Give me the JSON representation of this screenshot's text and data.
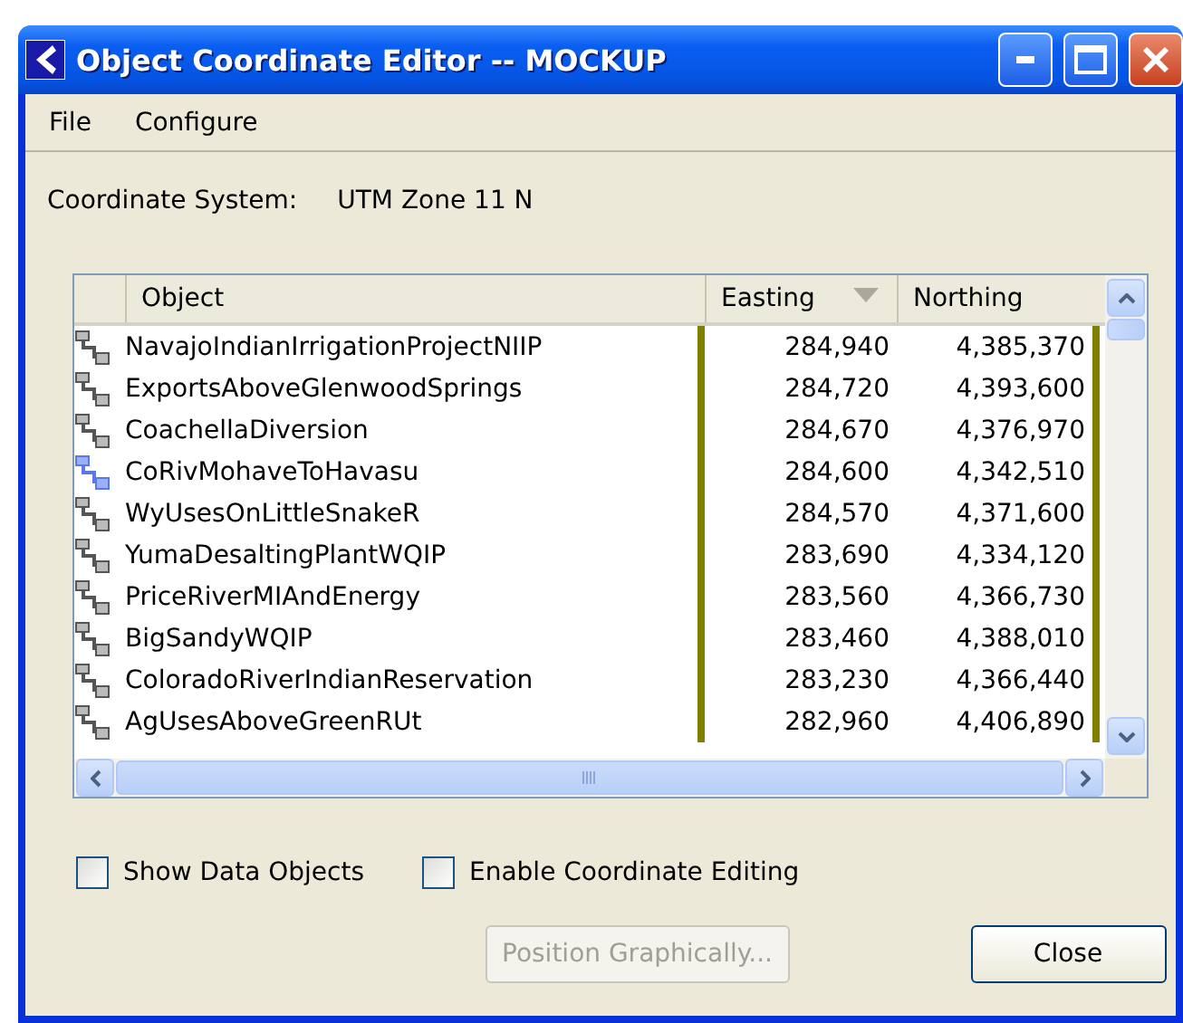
{
  "window": {
    "title": "Object Coordinate Editor -- MOCKUP"
  },
  "menu": [
    "File",
    "Configure"
  ],
  "coordinate_system": {
    "label": "Coordinate System:",
    "value": "UTM Zone 11 N"
  },
  "table": {
    "columns": [
      {
        "label": "Object",
        "sorted": false
      },
      {
        "label": "Easting",
        "sorted": true
      },
      {
        "label": "Northing",
        "sorted": false
      }
    ],
    "rows": [
      {
        "kind": "standard",
        "object": "NavajoIndianIrrigationProjectNIIP",
        "easting": "284,940",
        "northing": "4,385,370"
      },
      {
        "kind": "standard",
        "object": "ExportsAboveGlenwoodSprings",
        "easting": "284,720",
        "northing": "4,393,600"
      },
      {
        "kind": "standard",
        "object": "CoachellaDiversion",
        "easting": "284,670",
        "northing": "4,376,970"
      },
      {
        "kind": "alternate",
        "object": "CoRivMohaveToHavasu",
        "easting": "284,600",
        "northing": "4,342,510"
      },
      {
        "kind": "standard",
        "object": "WyUsesOnLittleSnakeR",
        "easting": "284,570",
        "northing": "4,371,600"
      },
      {
        "kind": "standard",
        "object": "YumaDesaltingPlantWQIP",
        "easting": "283,690",
        "northing": "4,334,120"
      },
      {
        "kind": "standard",
        "object": "PriceRiverMIAndEnergy",
        "easting": "283,560",
        "northing": "4,366,730"
      },
      {
        "kind": "standard",
        "object": "BigSandyWQIP",
        "easting": "283,460",
        "northing": "4,388,010"
      },
      {
        "kind": "standard",
        "object": "ColoradoRiverIndianReservation",
        "easting": "283,230",
        "northing": "4,366,440"
      },
      {
        "kind": "standard",
        "object": "AgUsesAboveGreenRUt",
        "easting": "282,960",
        "northing": "4,406,890"
      }
    ]
  },
  "checkboxes": [
    {
      "label": "Show Data Objects",
      "checked": false
    },
    {
      "label": "Enable Coordinate Editing",
      "checked": false
    }
  ],
  "buttons": [
    {
      "label": "Position Graphically...",
      "disabled": true
    },
    {
      "label": "Close",
      "disabled": false
    }
  ]
}
